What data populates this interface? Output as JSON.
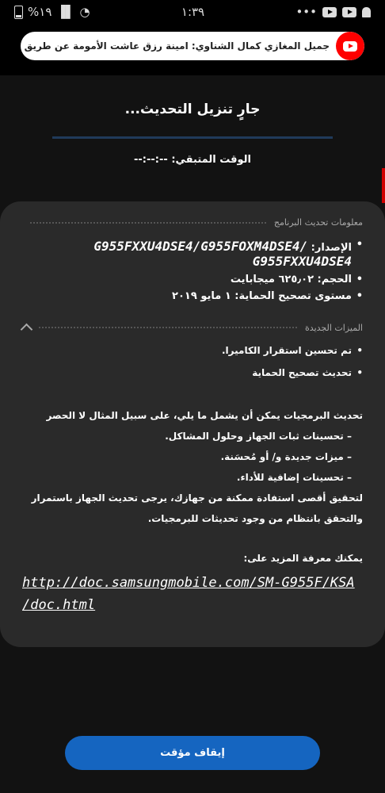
{
  "status_bar": {
    "time": "١:٣٩",
    "battery": "%١٩",
    "dots": "•••"
  },
  "notification": {
    "text": "جميل المغازي  كمال الشناوي: امينة رزق عاشت الأمومة عن طريق الفن | ذلا..."
  },
  "update": {
    "title": "جارٍ تنزيل التحديث...",
    "progress": 0,
    "remaining_label": "الوقت المتبقي:",
    "remaining_value": "--:--:--"
  },
  "card": {
    "info_header": "معلومات تحديث البرنامج",
    "version_label": "الإصدار:",
    "version_value": "G955FXXU4DSE4/G955FOXM4DSE4/ G955FXXU4DSE4",
    "size_label": "الحجم:",
    "size_value": "٦٢٥٫٠٢ ميجابايت",
    "patch_label": "مستوى تصحيح الحماية:",
    "patch_value": "١ مايو ٢٠١٩",
    "features_header": "الميزات الجديدة",
    "features": [
      "تم تحسين استقرار الكاميرا.",
      "تحديث تصحيح الحماية"
    ],
    "desc_intro": "تحديث البرمجيات يمكن أن يشمل ما يلي، على سبيل المثال لا الحصر",
    "desc_items": [
      "– تحسينات ثبات الجهاز وحلول المشاكل.",
      "– ميزات جديدة و/ أو مُحسَنة.",
      "– تحسينات إضافية للأداء."
    ],
    "desc_outro": "لتحقيق أقصى استفادة ممكنة من جهازك، يرجى تحديث الجهاز باستمرار والتحقق بانتظام من وجود تحديثات للبرمجيات.",
    "learn_more": "يمكنك معرفة المزيد على:",
    "link_line1": "http://doc.samsungmobile.com/SM-G955F/KSA",
    "link_line2": "/doc.html"
  },
  "pause_button": "إيقاف مؤقت",
  "colors": {
    "accent": "#1565c0",
    "youtube": "#ff0000",
    "card_bg": "#2a2a2a"
  }
}
